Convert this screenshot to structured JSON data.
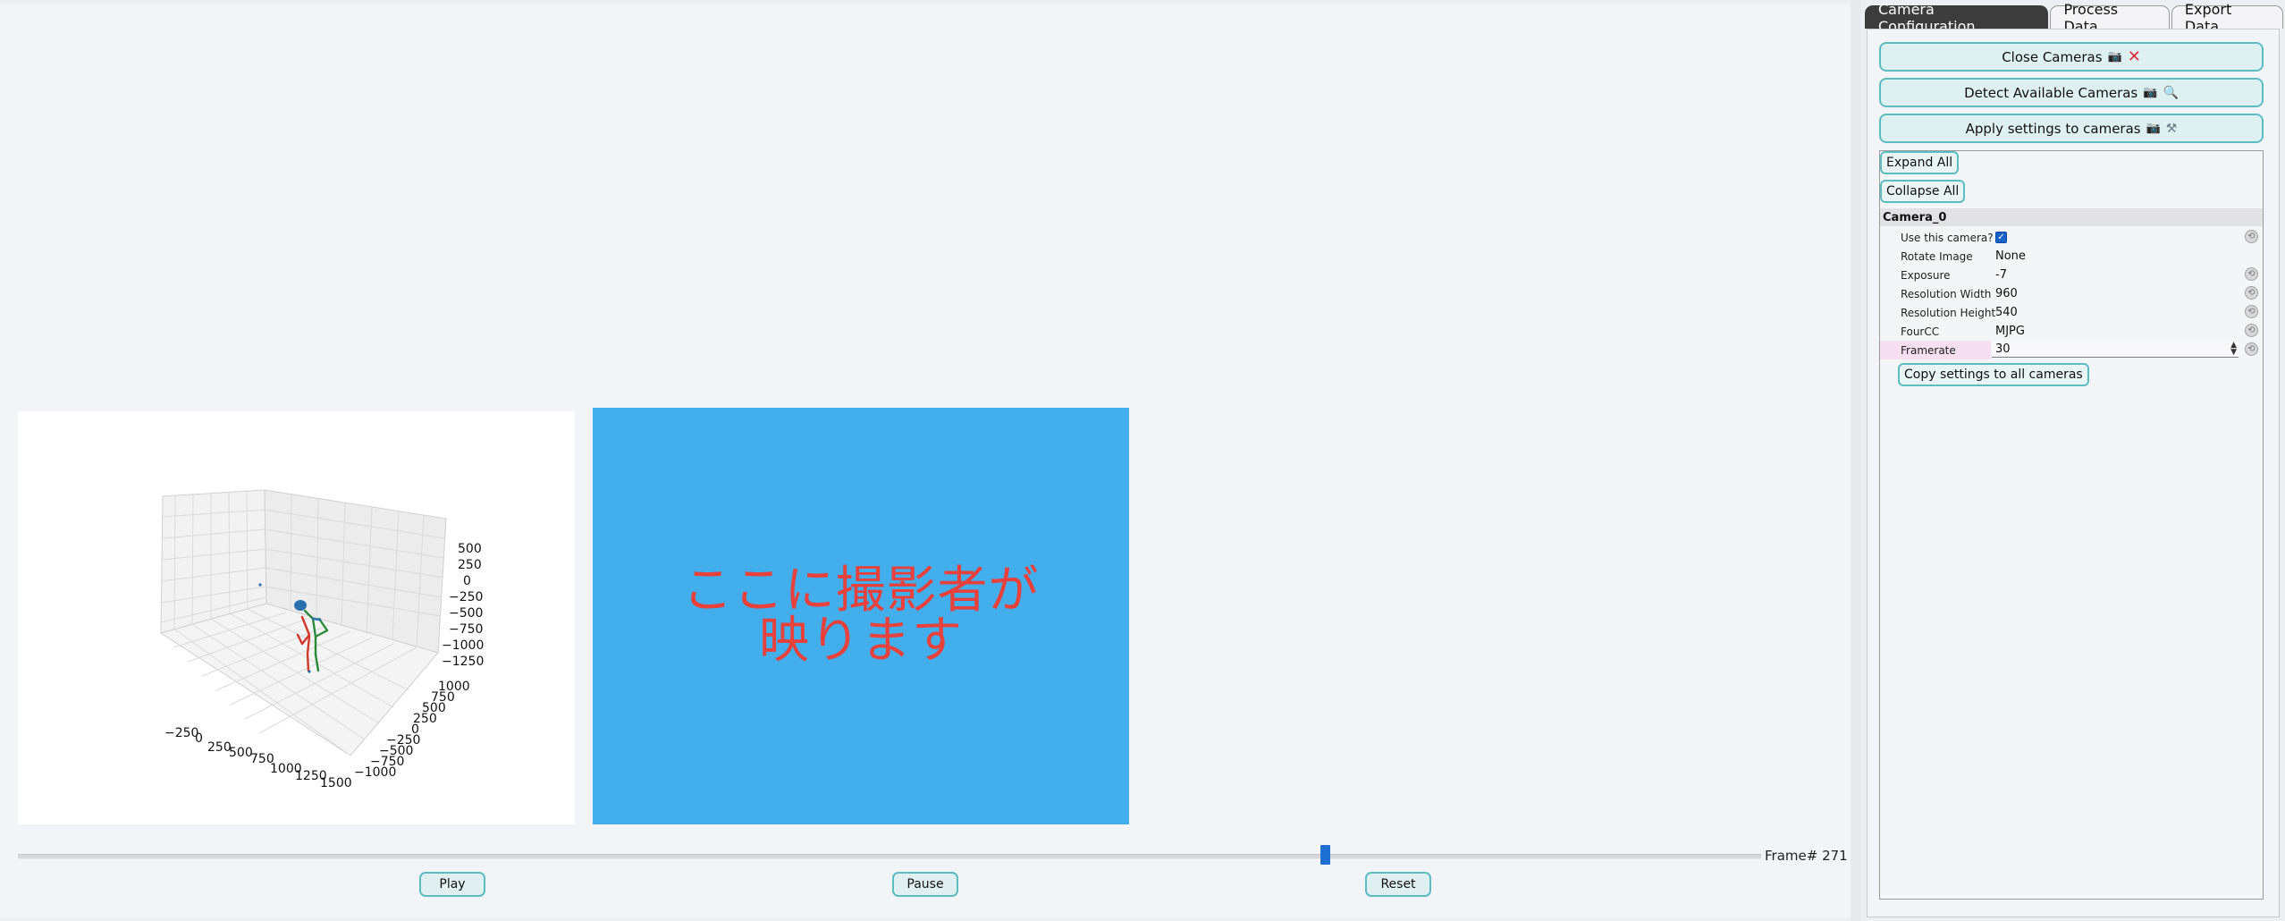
{
  "tabs": [
    {
      "label": "Camera Configuration",
      "active": true
    },
    {
      "label": "Process Data",
      "active": false
    },
    {
      "label": "Export Data",
      "active": false
    }
  ],
  "camera_buttons": {
    "close": {
      "label": "Close Cameras",
      "icons": [
        "camera-icon",
        "cross-mark-icon"
      ]
    },
    "detect": {
      "label": "Detect Available Cameras",
      "icons": [
        "camera-icon",
        "magnifier-icon"
      ]
    },
    "apply": {
      "label": "Apply settings to cameras",
      "icons": [
        "camera-icon",
        "tools-icon"
      ]
    }
  },
  "tree": {
    "expand_all": "Expand All",
    "collapse_all": "Collapse All",
    "group": "Camera_0",
    "params": {
      "use_camera": {
        "name": "Use this camera?",
        "checked": true
      },
      "rotate": {
        "name": "Rotate Image",
        "value": "None"
      },
      "exposure": {
        "name": "Exposure",
        "value": "-7"
      },
      "res_w": {
        "name": "Resolution Width",
        "value": "960"
      },
      "res_h": {
        "name": "Resolution Height",
        "value": "540"
      },
      "fourcc": {
        "name": "FourCC",
        "value": "MJPG"
      },
      "framerate": {
        "name": "Framerate",
        "value": "30"
      }
    },
    "copy_button": "Copy settings to all cameras"
  },
  "plot": {
    "z_ticks": [
      "500",
      "250",
      "0",
      "−250",
      "−500",
      "−750",
      "−1000",
      "−1250"
    ],
    "y_ticks": [
      "1000",
      "750",
      "500",
      "250",
      "0",
      "−250",
      "−500",
      "−750",
      "−1000"
    ],
    "x_ticks": [
      "−250",
      "0",
      "250",
      "500",
      "750",
      "1000",
      "1250",
      "1500"
    ]
  },
  "video": {
    "line1": "ここに撮影者が",
    "line2": "映ります"
  },
  "playback": {
    "frame_label": "Frame# 271",
    "progress_fraction": 0.75,
    "play": "Play",
    "pause": "Pause",
    "reset": "Reset"
  },
  "colors": {
    "accent_border": "#5cbcc0",
    "slider_handle": "#1d6fd1",
    "video_bg": "#42aeec",
    "video_text": "#e8403a"
  }
}
